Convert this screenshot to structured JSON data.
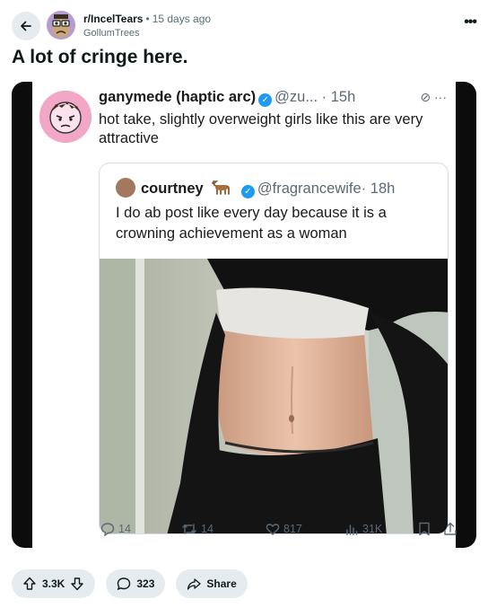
{
  "header": {
    "subreddit": "r/IncelTears",
    "separator": "•",
    "time_ago": "15 days ago",
    "author": "GollumTrees",
    "overflow_label": "•••"
  },
  "post": {
    "title": "A lot of cringe here."
  },
  "tweet": {
    "name": "ganymede (haptic arc)",
    "handle": "@zu...",
    "time": "· 15h",
    "text": "hot take, slightly overweight girls like this are very attractive",
    "quote": {
      "name": "courtney",
      "handle": "@fragrancewife",
      "time": "· 18h",
      "text": "I do ab post like every day because it is a crowning achievement as a woman"
    },
    "stats": {
      "replies": "14",
      "retweets": "14",
      "likes": "817",
      "views": "31K"
    }
  },
  "actions": {
    "votes": "3.3K",
    "comments": "323",
    "share": "Share"
  },
  "colors": {
    "accent_bg": "#e5ebee",
    "verified": "#1d9bf0",
    "text_muted": "#576f76"
  }
}
